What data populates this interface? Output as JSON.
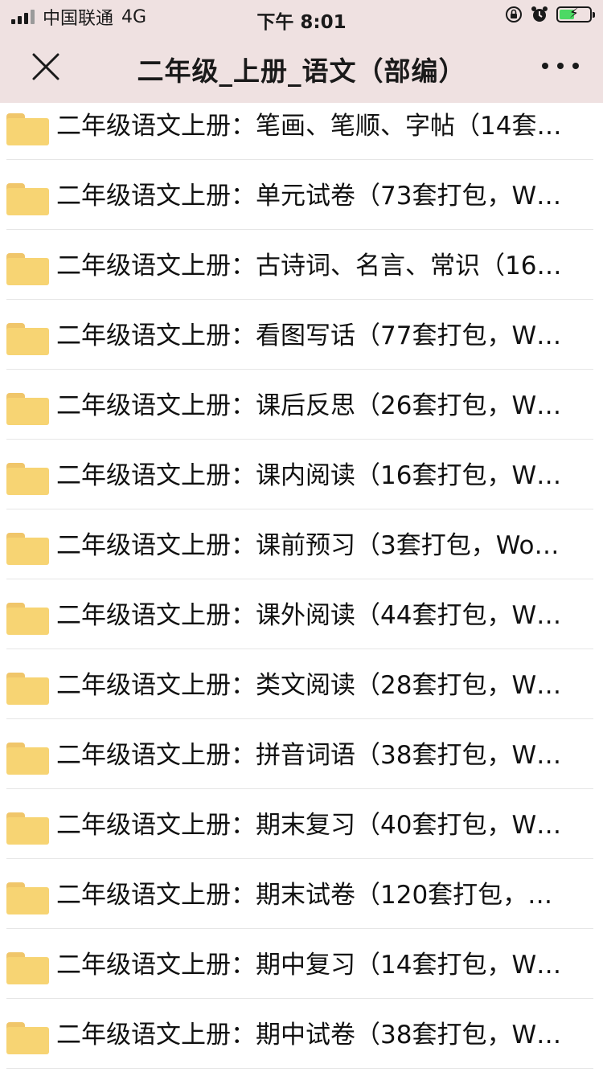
{
  "status_bar": {
    "carrier": "中国联通",
    "network": "4G",
    "time": "下午 8:01"
  },
  "nav": {
    "title": "二年级_上册_语文（部编）"
  },
  "files": [
    {
      "name": "二年级语文上册：笔画、笔顺、字帖（14套…"
    },
    {
      "name": "二年级语文上册：单元试卷（73套打包，W…"
    },
    {
      "name": "二年级语文上册：古诗词、名言、常识（16…"
    },
    {
      "name": "二年级语文上册：看图写话（77套打包，W…"
    },
    {
      "name": "二年级语文上册：课后反思（26套打包，W…"
    },
    {
      "name": "二年级语文上册：课内阅读（16套打包，W…"
    },
    {
      "name": "二年级语文上册：课前预习（3套打包，Wo…"
    },
    {
      "name": "二年级语文上册：课外阅读（44套打包，W…"
    },
    {
      "name": "二年级语文上册：类文阅读（28套打包，W…"
    },
    {
      "name": "二年级语文上册：拼音词语（38套打包，W…"
    },
    {
      "name": "二年级语文上册：期末复习（40套打包，W…"
    },
    {
      "name": "二年级语文上册：期末试卷（120套打包，…"
    },
    {
      "name": "二年级语文上册：期中复习（14套打包，W…"
    },
    {
      "name": "二年级语文上册：期中试卷（38套打包，W…"
    }
  ],
  "colors": {
    "header_bg": "#efe1e1",
    "folder": "#f7d473",
    "battery": "#4cd964"
  }
}
